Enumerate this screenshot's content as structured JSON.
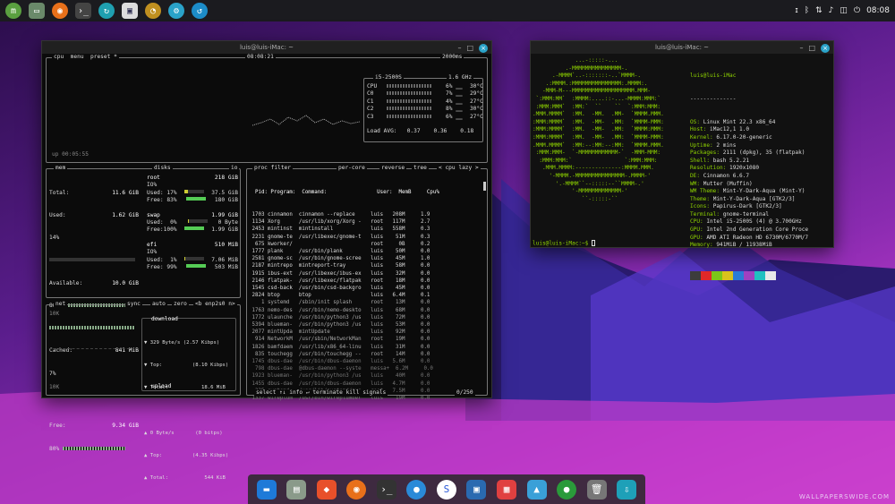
{
  "panel": {
    "clock": "08:08",
    "tray_icons": [
      "update-icon",
      "bluetooth-icon",
      "network-icon",
      "volume-icon",
      "notification-icon",
      "power-icon"
    ]
  },
  "btop": {
    "title": "luis@luis-iMac: ~",
    "header": {
      "cpu": "cpu",
      "menu": "menu",
      "preset": "preset *",
      "time": "08:08:21",
      "rate": "2000ms"
    },
    "uptime": "up 00:05:55",
    "cpu_model": "i5-2500S",
    "cpu_freq": "1.6 GHz",
    "cores": [
      {
        "name": "CPU",
        "pct": "6%",
        "temp": "30°C"
      },
      {
        "name": "C0",
        "pct": "7%",
        "temp": "29°C"
      },
      {
        "name": "C1",
        "pct": "4%",
        "temp": "27°C"
      },
      {
        "name": "C2",
        "pct": "8%",
        "temp": "30°C"
      },
      {
        "name": "C3",
        "pct": "6%",
        "temp": "27°C"
      }
    ],
    "load": "Load AVG:   0.37    0.36    0.18",
    "mem": {
      "title": "mem",
      "total_label": "Total:",
      "total": "11.6 GiB",
      "used_label": "Used:",
      "used": "1.62 GiB",
      "used_pct": "14%",
      "avail_label": "Available:",
      "avail": "10.0 GiB",
      "avail_pct": "86%",
      "cached_label": "Cached:",
      "cached": "841 MiB",
      "cached_pct": "7%",
      "free_label": "Free:",
      "free": "9.34 GiB",
      "free_pct": "80%"
    },
    "disks": {
      "title": "disks",
      "io": "io",
      "items": [
        {
          "name": "root",
          "size": "218 GiB",
          "io": "IO%",
          "used": "Used: 17%",
          "used_v": "37.5 GiB",
          "free": "Free: 83%",
          "free_v": "180 GiB",
          "frac": 0.17
        },
        {
          "name": "swap",
          "size": "1.99 GiB",
          "io": "",
          "used": "Used:  0%",
          "used_v": "0 Byte",
          "free": "Free:100%",
          "free_v": "1.99 GiB",
          "frac": 0.0
        },
        {
          "name": "efi",
          "size": "510 MiB",
          "io": "IO%",
          "used": "Used:  1%",
          "used_v": "7.06 MiB",
          "free": "Free: 99%",
          "free_v": "503 MiB",
          "frac": 0.01
        }
      ]
    },
    "net": {
      "title": "net",
      "sync": "sync",
      "auto": "auto",
      "zero": "zero",
      "iface": "<b enp2s0 n>",
      "top_scale": "10K",
      "bottom_scale": "10K",
      "download": "download",
      "dl_rate": "▼ 329 Byte/s (2.57 Kibps)",
      "dl_top": "▼ Top:          (8.10 Kibps)",
      "dl_total": "▼ Total:           18.6 MiB",
      "ul_rate": "▲ 0 Byte/s       (0 bitps)",
      "ul_top": "▲ Top:          (4.35 Kibps)",
      "ul_total": "▲ Total:            544 KiB",
      "upload": "upload"
    },
    "proc": {
      "title": "proc",
      "filter": "filter",
      "per_core": "per-core",
      "reverse": "reverse",
      "tree": "tree",
      "sort": "< cpu lazy >",
      "headers": "  Pid: Program:  Command:                User:  MemB     Cpu%",
      "rows": [
        " 1703 cinnamon  cinnamon --replace     luis   208M     1.9",
        " 1134 Xorg      /usr/lib/xorg/Xorg -   root   117M     2.7",
        " 2453 mintinst  mintinstall            luis   558M     0.3",
        " 2231 gnome-te  /usr/libexec/gnome-t   luis    51M     0.3",
        "  675 kworker/                         root     0B     0.2",
        " 1777 plank     /usr/bin/plank         luis    50M     0.0",
        " 2581 gnome-sc  /usr/bin/gnome-scree   luis    45M     1.0",
        " 2187 mintrepo  mintreport-tray        luis    58M     0.0",
        " 1915 ibus-ext  /usr/libexec/ibus-ex   luis    32M     0.0",
        " 2146 flatpak-  /usr/libexec/flatpak   root    18M     0.0",
        " 1545 csd-back  /usr/bin/csd-backgro   luis    45M     0.0",
        " 2824 btop      btop                   luis   6.4M     0.1",
        "    1 systemd   /sbin/init splash      root    13M     0.0",
        " 1763 nemo-des  /usr/bin/nemo-deskto   luis    68M     0.0",
        " 1772 ulaunche  /usr/bin/python3 /us   luis    72M     0.0",
        " 5394 blueman-  /usr/bin/python3 /us   luis    53M     0.0",
        " 2077 mintUpda  mintUpdate             luis    92M     0.0",
        "  914 NetworkM  /usr/sbin/NetworkMan   root    19M     0.0",
        " 1826 bamfdaem  /usr/lib/x86_64-linu   luis    31M     0.0",
        "  835 touchegg  /usr/bin/touchegg --   root    14M     0.0",
        " 1745 dbus-dae  /usr/bin/dbus-daemon   luis   5.6M     0.0",
        "  798 dbus-dae  @dbus-daemon --syste   messa+  6.2M     0.0",
        " 1923 blueman-  /usr/bin/python3 /us   luis    40M     0.0",
        " 1455 dbus-dae  /usr/bin/dbus-daemon   luis   4.7M     0.0",
        "  335 systemd-  /usr/lib/systemd/sys   root   7.5M     0.0",
        " 1337 wireplum  /usr/bin/wireplumber   luis    19M     0.0"
      ],
      "footer": "select ↑↓ info ↵ terminate kill signals",
      "count": "0/250"
    }
  },
  "neofetch": {
    "title": "luis@luis-iMac: ~",
    "logo": [
      "             ...-:::::-...",
      "          .-MMMMMMMMMMMMMMM-.",
      "      .-MMMM`..-:::::::-..`MMMM-.",
      "    .:MMMM.:MMMMMMMMMMMMMMM:.MMMM:.",
      "   -MMM-M---MMMMMMMMMMMMMMMMMMM.MMM-",
      " `:MMM:MM`  :MMMM:....::-...-MMMM:MMM:`",
      " :MMM:MMM`  :MM:`  ``    ``  `:MMM:MMM:",
      ".MMM.MMMM`  :MM.  -MM.  .MM-  `MMMM.MMM.",
      ":MMM:MMMM`  :MM.  -MM-  .MM:  `MMMM-MMM:",
      ":MMM:MMMM`  :MM.  -MM-  .MM:  `MMMM:MMM:",
      ":MMM:MMMM`  :MM.  -MM-  .MM:  `MMMM-MMM:",
      ".MMM.MMMM`  :MM:--:MM:--:MM:  `MMMM.MMM.",
      " :MMM:MMM-  `-MMMMMMMMMMMM-`  -MMM-MMM:",
      "  :MMM:MMM:`                `:MMM:MMM:",
      "   .MMM.MMMM:--------------:MMMM.MMM.",
      "     '-MMMM.-MMMMMMMMMMMMMMM-.MMMM-'",
      "       '.-MMMM``--:::::--``MMMM-.'",
      "            '-MMMMMMMMMMMMM-'",
      "               ``-:::::-``"
    ],
    "user_host": "luis@luis-iMac",
    "separator": "--------------",
    "info": [
      {
        "k": "OS",
        "v": "Linux Mint 22.3 x86_64"
      },
      {
        "k": "Host",
        "v": "iMac12,1 1.0"
      },
      {
        "k": "Kernel",
        "v": "6.17.0-20-generic"
      },
      {
        "k": "Uptime",
        "v": "2 mins"
      },
      {
        "k": "Packages",
        "v": "2111 (dpkg), 35 (flatpak)"
      },
      {
        "k": "Shell",
        "v": "bash 5.2.21"
      },
      {
        "k": "Resolution",
        "v": "1920x1080"
      },
      {
        "k": "DE",
        "v": "Cinnamon 6.6.7"
      },
      {
        "k": "WM",
        "v": "Mutter (Muffin)"
      },
      {
        "k": "WM Theme",
        "v": "Mint-Y-Dark-Aqua (Mint-Y)"
      },
      {
        "k": "Theme",
        "v": "Mint-Y-Dark-Aqua [GTK2/3]"
      },
      {
        "k": "Icons",
        "v": "Papirus-Dark [GTK2/3]"
      },
      {
        "k": "Terminal",
        "v": "gnome-terminal"
      },
      {
        "k": "CPU",
        "v": "Intel i5-2500S (4) @ 3.700GHz"
      },
      {
        "k": "GPU",
        "v": "Intel 2nd Generation Core Proce"
      },
      {
        "k": "GPU",
        "v": "AMD ATI Radeon HD 6730M/6770M/7"
      },
      {
        "k": "Memory",
        "v": "941MiB / 11938MiB"
      }
    ],
    "swatches": [
      "#3c3c3c",
      "#e02828",
      "#7bc618",
      "#d9c21b",
      "#2a7bd6",
      "#a040c0",
      "#20c0c0",
      "#e8e8e8"
    ],
    "prompt": "luis@luis-iMac:~$ "
  },
  "watermark": "WALLPAPERSWIDE.COM",
  "colors": {
    "accent": "#8fd400",
    "btop_green": "#7fd07f",
    "close": "#2aa3c9"
  }
}
